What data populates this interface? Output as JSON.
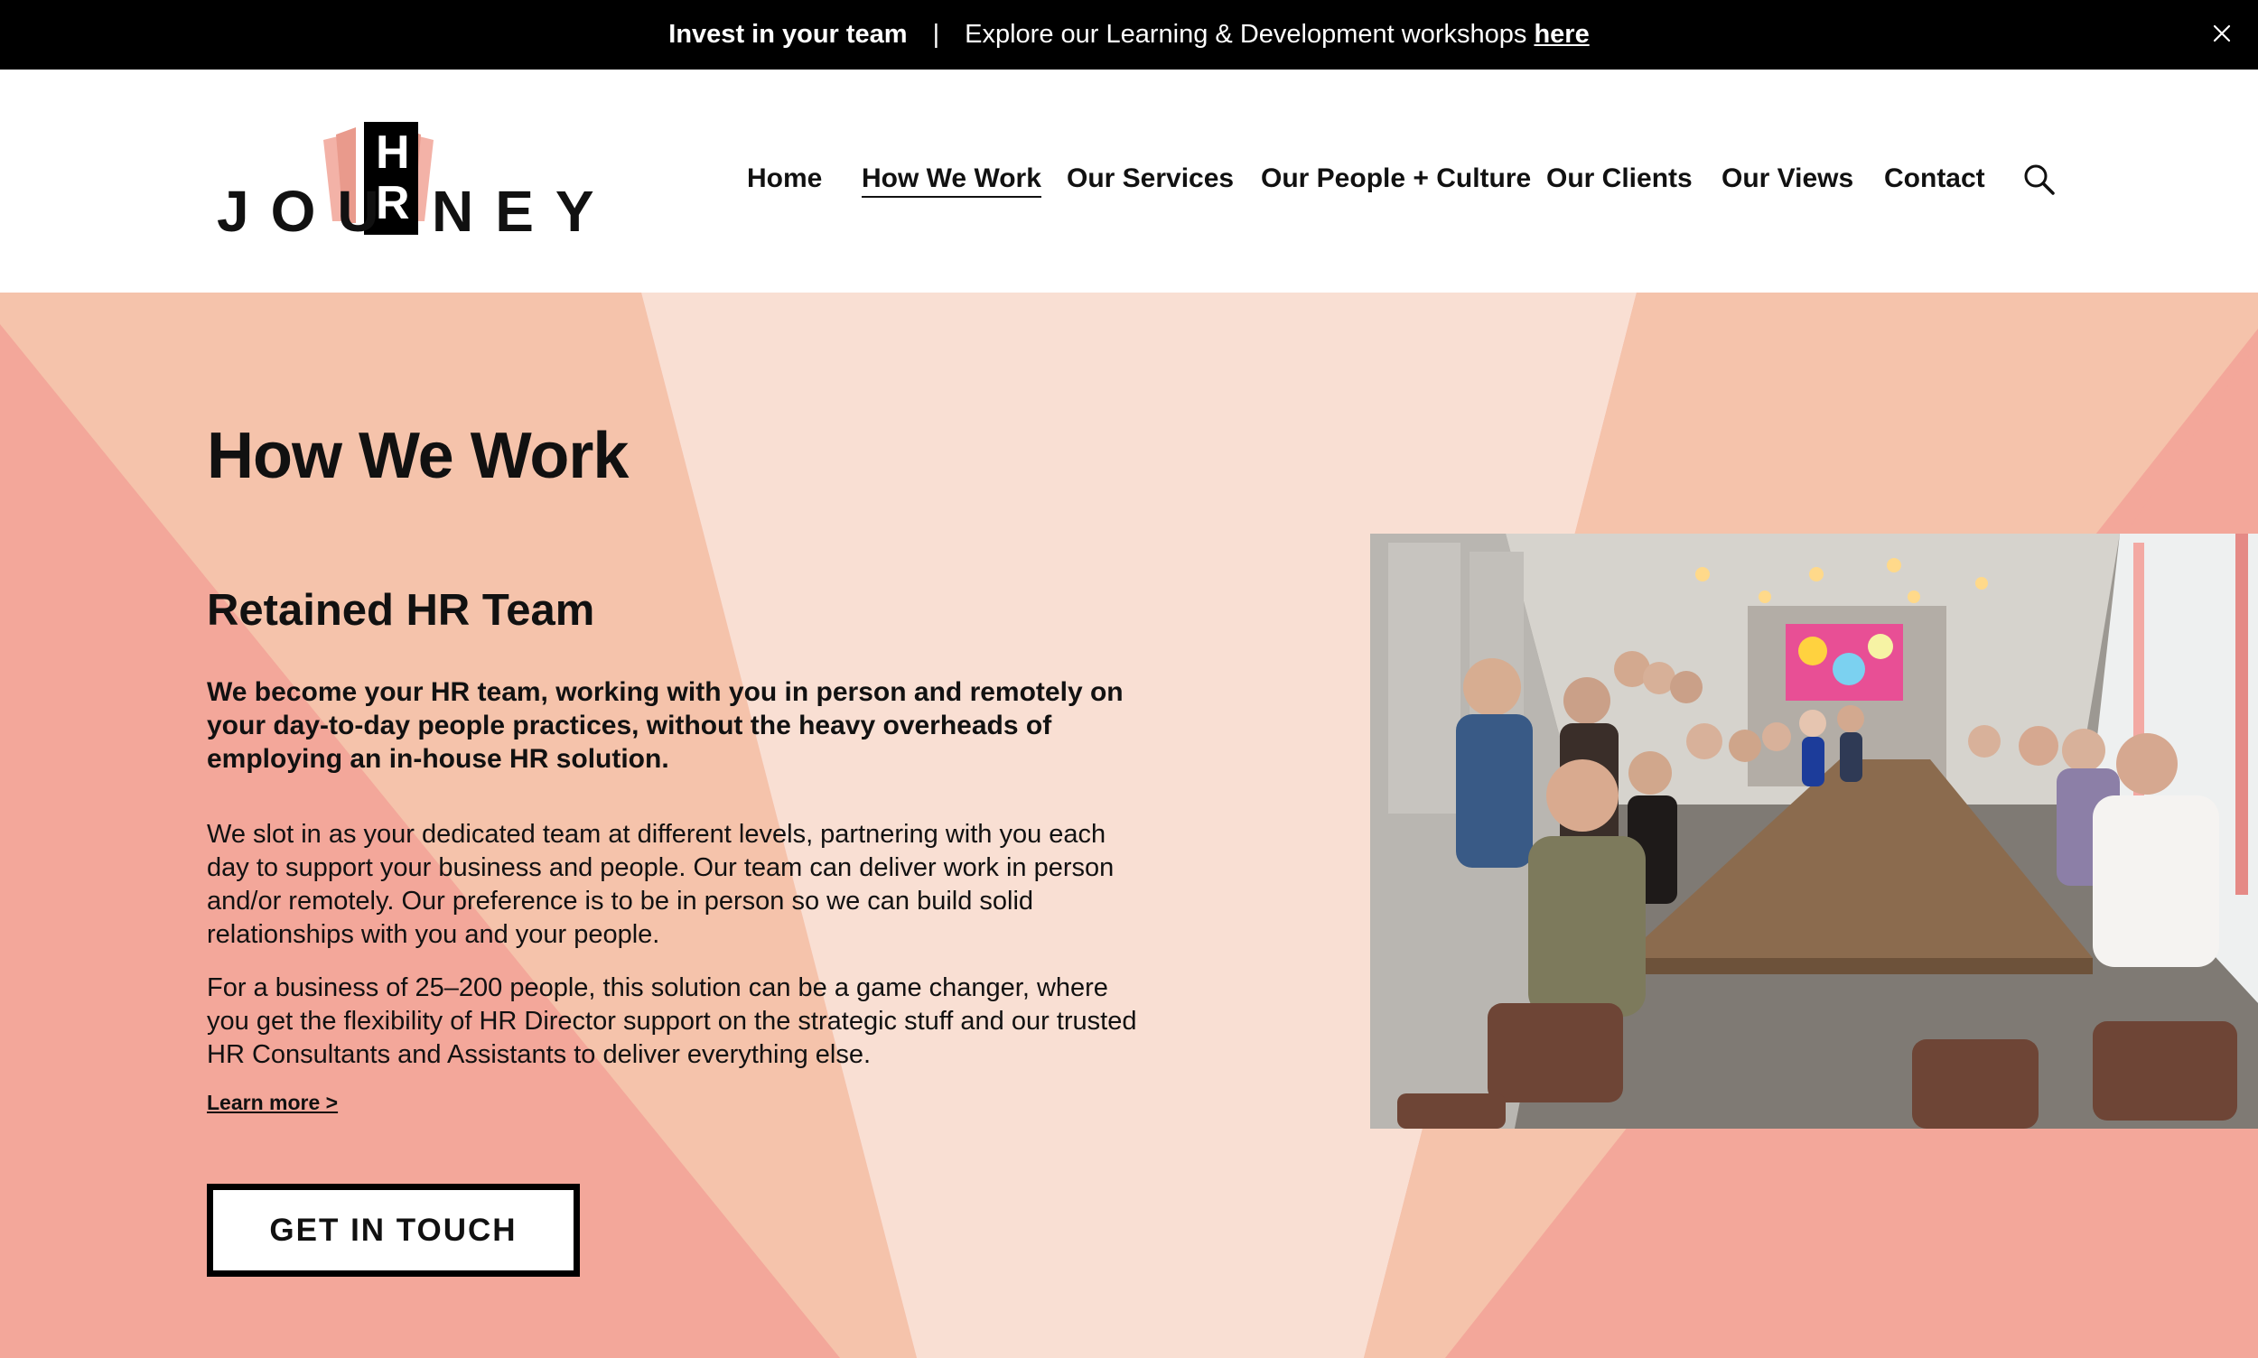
{
  "announcement": {
    "bold_text": "Invest in your team",
    "separator": "|",
    "text": "Explore our Learning & Development workshops",
    "link_text": "here",
    "close_icon": "close-icon"
  },
  "logo": {
    "letters_left": "JOU",
    "letters_box_top": "H",
    "letters_box_bottom": "R",
    "letters_right": "NEY"
  },
  "nav": {
    "items": [
      {
        "label": "Home",
        "active": false
      },
      {
        "label": "How We Work",
        "active": true
      },
      {
        "label": "Our Services",
        "active": false
      },
      {
        "label": "Our People + Culture",
        "active": false
      },
      {
        "label": "Our Clients",
        "active": false
      },
      {
        "label": "Our Views",
        "active": false
      },
      {
        "label": "Contact",
        "active": false
      }
    ],
    "search_icon": "search-icon"
  },
  "hero": {
    "page_title": "How We Work",
    "section_title": "Retained HR Team",
    "intro": "We become your HR team, working with you in person and remotely on your day-to-day people practices, without the heavy overheads of employing an in-house HR solution.",
    "paragraph_1": "We slot in as your dedicated team at different levels, partnering with you each day to support your business and people. Our team can deliver work in person and/or remotely. Our preference is to be in person so we can build solid relationships with you and your people.",
    "paragraph_2": "For a business of 25–200 people, this solution can be a game changer, where you get the flexibility of HR Director support on the strategic stuff and our trusted HR Consultants and Assistants to deliver everything else.",
    "learn_more": "Learn more >",
    "cta": "GET IN TOUCH"
  },
  "colors": {
    "announcement_bg": "#000000",
    "salmon": "#f3a79a",
    "peach": "#f5c3ab",
    "light_peach": "#f9dfd3",
    "logo_pink": "#e99a8c"
  }
}
